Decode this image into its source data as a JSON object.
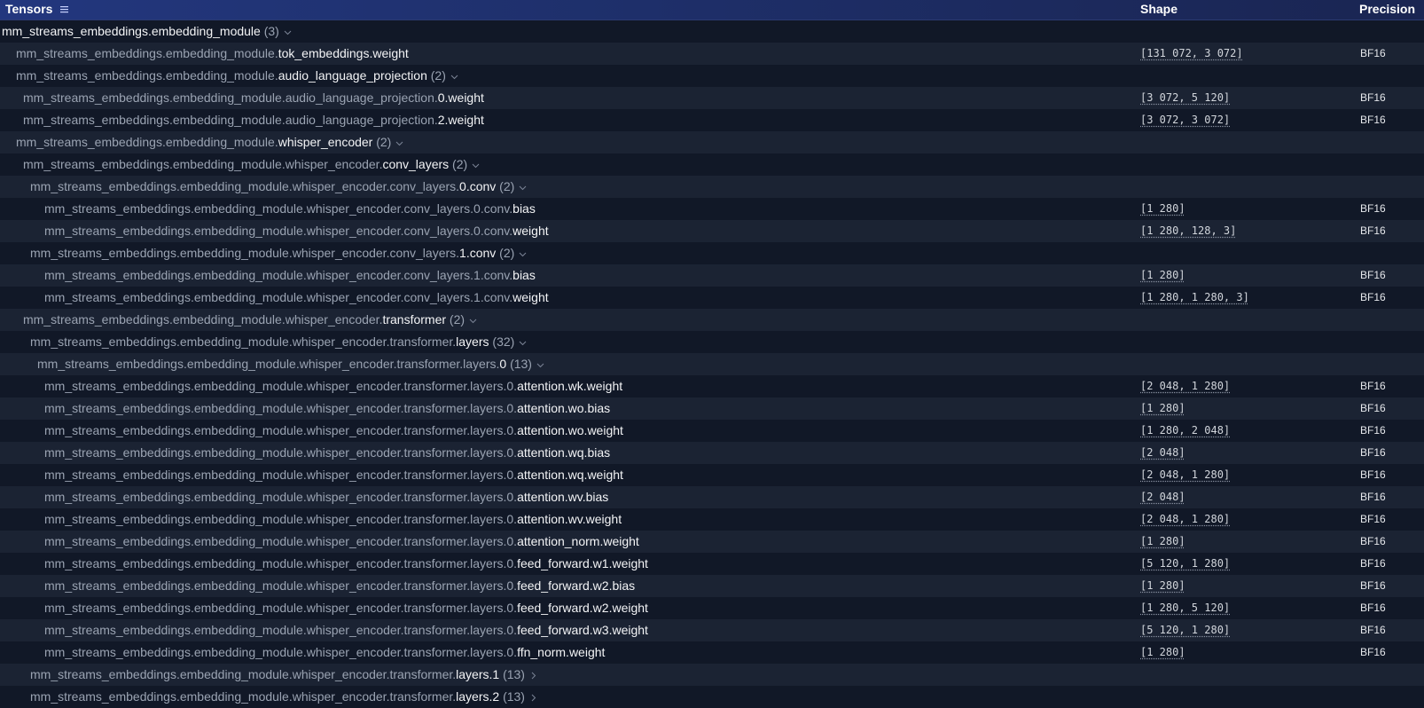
{
  "header": {
    "tensors": "Tensors",
    "shape": "Shape",
    "precision": "Precision",
    "menu_icon": "list-menu-icon"
  },
  "rows": [
    {
      "prefix": "",
      "leaf": "mm_streams_embeddings.embedding_module",
      "count": "(3)",
      "chevron": "down",
      "shape": "",
      "precision": ""
    },
    {
      "prefix": "mm_streams_embeddings.embedding_module.",
      "leaf": "tok_embeddings.weight",
      "count": "",
      "chevron": "",
      "shape": "[131 072, 3 072]",
      "precision": "BF16"
    },
    {
      "prefix": "mm_streams_embeddings.embedding_module.",
      "leaf": "audio_language_projection",
      "count": "(2)",
      "chevron": "down",
      "shape": "",
      "precision": ""
    },
    {
      "prefix": "mm_streams_embeddings.embedding_module.audio_language_projection.",
      "leaf": "0.weight",
      "count": "",
      "chevron": "",
      "shape": "[3 072, 5 120]",
      "precision": "BF16"
    },
    {
      "prefix": "mm_streams_embeddings.embedding_module.audio_language_projection.",
      "leaf": "2.weight",
      "count": "",
      "chevron": "",
      "shape": "[3 072, 3 072]",
      "precision": "BF16"
    },
    {
      "prefix": "mm_streams_embeddings.embedding_module.",
      "leaf": "whisper_encoder",
      "count": "(2)",
      "chevron": "down",
      "shape": "",
      "precision": ""
    },
    {
      "prefix": "mm_streams_embeddings.embedding_module.whisper_encoder.",
      "leaf": "conv_layers",
      "count": "(2)",
      "chevron": "down",
      "shape": "",
      "precision": ""
    },
    {
      "prefix": "mm_streams_embeddings.embedding_module.whisper_encoder.conv_layers.",
      "leaf": "0.conv",
      "count": "(2)",
      "chevron": "down",
      "shape": "",
      "precision": ""
    },
    {
      "prefix": "mm_streams_embeddings.embedding_module.whisper_encoder.conv_layers.0.conv.",
      "leaf": "bias",
      "count": "",
      "chevron": "",
      "shape": "[1 280]",
      "precision": "BF16"
    },
    {
      "prefix": "mm_streams_embeddings.embedding_module.whisper_encoder.conv_layers.0.conv.",
      "leaf": "weight",
      "count": "",
      "chevron": "",
      "shape": "[1 280, 128, 3]",
      "precision": "BF16"
    },
    {
      "prefix": "mm_streams_embeddings.embedding_module.whisper_encoder.conv_layers.",
      "leaf": "1.conv",
      "count": "(2)",
      "chevron": "down",
      "shape": "",
      "precision": ""
    },
    {
      "prefix": "mm_streams_embeddings.embedding_module.whisper_encoder.conv_layers.1.conv.",
      "leaf": "bias",
      "count": "",
      "chevron": "",
      "shape": "[1 280]",
      "precision": "BF16"
    },
    {
      "prefix": "mm_streams_embeddings.embedding_module.whisper_encoder.conv_layers.1.conv.",
      "leaf": "weight",
      "count": "",
      "chevron": "",
      "shape": "[1 280, 1 280, 3]",
      "precision": "BF16"
    },
    {
      "prefix": "mm_streams_embeddings.embedding_module.whisper_encoder.",
      "leaf": "transformer",
      "count": "(2)",
      "chevron": "down",
      "shape": "",
      "precision": ""
    },
    {
      "prefix": "mm_streams_embeddings.embedding_module.whisper_encoder.transformer.",
      "leaf": "layers",
      "count": "(32)",
      "chevron": "down",
      "shape": "",
      "precision": ""
    },
    {
      "prefix": "mm_streams_embeddings.embedding_module.whisper_encoder.transformer.layers.",
      "leaf": "0",
      "count": "(13)",
      "chevron": "down",
      "shape": "",
      "precision": ""
    },
    {
      "prefix": "mm_streams_embeddings.embedding_module.whisper_encoder.transformer.layers.0.",
      "leaf": "attention.wk.weight",
      "count": "",
      "chevron": "",
      "shape": "[2 048, 1 280]",
      "precision": "BF16"
    },
    {
      "prefix": "mm_streams_embeddings.embedding_module.whisper_encoder.transformer.layers.0.",
      "leaf": "attention.wo.bias",
      "count": "",
      "chevron": "",
      "shape": "[1 280]",
      "precision": "BF16"
    },
    {
      "prefix": "mm_streams_embeddings.embedding_module.whisper_encoder.transformer.layers.0.",
      "leaf": "attention.wo.weight",
      "count": "",
      "chevron": "",
      "shape": "[1 280, 2 048]",
      "precision": "BF16"
    },
    {
      "prefix": "mm_streams_embeddings.embedding_module.whisper_encoder.transformer.layers.0.",
      "leaf": "attention.wq.bias",
      "count": "",
      "chevron": "",
      "shape": "[2 048]",
      "precision": "BF16"
    },
    {
      "prefix": "mm_streams_embeddings.embedding_module.whisper_encoder.transformer.layers.0.",
      "leaf": "attention.wq.weight",
      "count": "",
      "chevron": "",
      "shape": "[2 048, 1 280]",
      "precision": "BF16"
    },
    {
      "prefix": "mm_streams_embeddings.embedding_module.whisper_encoder.transformer.layers.0.",
      "leaf": "attention.wv.bias",
      "count": "",
      "chevron": "",
      "shape": "[2 048]",
      "precision": "BF16"
    },
    {
      "prefix": "mm_streams_embeddings.embedding_module.whisper_encoder.transformer.layers.0.",
      "leaf": "attention.wv.weight",
      "count": "",
      "chevron": "",
      "shape": "[2 048, 1 280]",
      "precision": "BF16"
    },
    {
      "prefix": "mm_streams_embeddings.embedding_module.whisper_encoder.transformer.layers.0.",
      "leaf": "attention_norm.weight",
      "count": "",
      "chevron": "",
      "shape": "[1 280]",
      "precision": "BF16"
    },
    {
      "prefix": "mm_streams_embeddings.embedding_module.whisper_encoder.transformer.layers.0.",
      "leaf": "feed_forward.w1.weight",
      "count": "",
      "chevron": "",
      "shape": "[5 120, 1 280]",
      "precision": "BF16"
    },
    {
      "prefix": "mm_streams_embeddings.embedding_module.whisper_encoder.transformer.layers.0.",
      "leaf": "feed_forward.w2.bias",
      "count": "",
      "chevron": "",
      "shape": "[1 280]",
      "precision": "BF16"
    },
    {
      "prefix": "mm_streams_embeddings.embedding_module.whisper_encoder.transformer.layers.0.",
      "leaf": "feed_forward.w2.weight",
      "count": "",
      "chevron": "",
      "shape": "[1 280, 5 120]",
      "precision": "BF16"
    },
    {
      "prefix": "mm_streams_embeddings.embedding_module.whisper_encoder.transformer.layers.0.",
      "leaf": "feed_forward.w3.weight",
      "count": "",
      "chevron": "",
      "shape": "[5 120, 1 280]",
      "precision": "BF16"
    },
    {
      "prefix": "mm_streams_embeddings.embedding_module.whisper_encoder.transformer.layers.0.",
      "leaf": "ffn_norm.weight",
      "count": "",
      "chevron": "",
      "shape": "[1 280]",
      "precision": "BF16"
    },
    {
      "prefix": "mm_streams_embeddings.embedding_module.whisper_encoder.transformer.",
      "leaf": "layers.1",
      "count": "(13)",
      "chevron": "right",
      "shape": "",
      "precision": ""
    },
    {
      "prefix": "mm_streams_embeddings.embedding_module.whisper_encoder.transformer.",
      "leaf": "layers.2",
      "count": "(13)",
      "chevron": "right",
      "shape": "",
      "precision": ""
    }
  ],
  "colors": {
    "header_bg_start": "#23377e",
    "header_bg_end": "#1a2552",
    "row_odd": "#111827",
    "row_even": "#1b2333",
    "prefix_text": "#9aa3b2",
    "leaf_text": "#f3f4f6"
  }
}
